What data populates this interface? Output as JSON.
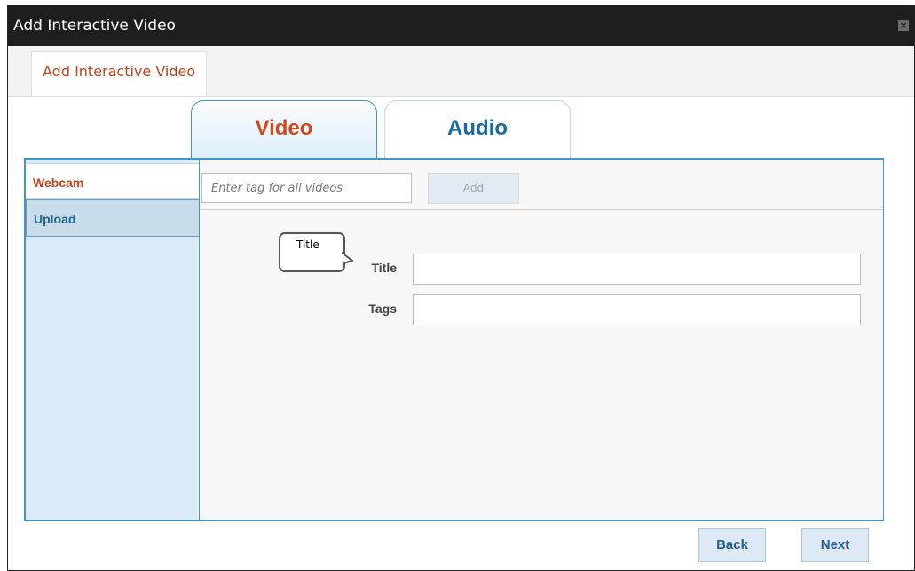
{
  "window": {
    "title": "Add Interactive Video",
    "close_glyph": "×"
  },
  "top_tab": {
    "label": "Add Interactive Video"
  },
  "media_tabs": {
    "video": "Video",
    "audio": "Audio"
  },
  "sidebar": {
    "items": [
      {
        "label": "Webcam"
      },
      {
        "label": "Upload"
      }
    ]
  },
  "tag_bar": {
    "placeholder": "Enter tag for all videos",
    "add_label": "Add"
  },
  "tooltip": {
    "text": "Title"
  },
  "form": {
    "title_label": "Title",
    "tags_label": "Tags",
    "title_value": "",
    "tags_value": ""
  },
  "footer": {
    "back_label": "Back",
    "next_label": "Next"
  },
  "colors": {
    "accent_orange": "#d2481c",
    "accent_blue": "#1a6aa0",
    "panel_border": "#3f97c8",
    "titlebar": "#1e1e1e"
  },
  "icons": {
    "close": "close-icon"
  }
}
